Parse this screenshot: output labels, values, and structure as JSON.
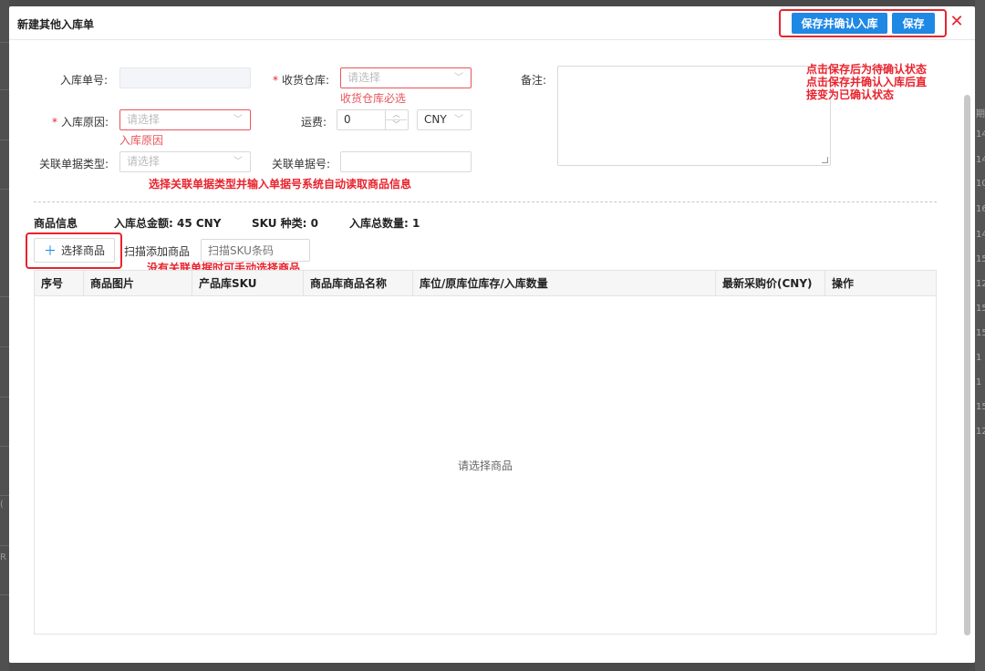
{
  "background": {
    "right_numbers": [
      "期",
      "14",
      "14",
      "10",
      "16",
      "14",
      "15",
      "12",
      "15",
      "15",
      "1",
      "1",
      "15",
      "12"
    ],
    "left_glyphs": [
      "(",
      "R"
    ]
  },
  "modal": {
    "title": "新建其他入库单",
    "buttons": {
      "confirm": "保存并确认入库",
      "save": "保存"
    },
    "close_icon": "close-icon"
  },
  "form": {
    "order_no_label": "入库单号:",
    "warehouse_label": "收货仓库:",
    "warehouse_placeholder": "请选择",
    "warehouse_error": "收货仓库必选",
    "remark_label": "备注:",
    "reason_label": "入库原因:",
    "reason_placeholder": "请选择",
    "reason_error": "入库原因",
    "freight_label": "运费:",
    "freight_value": "0",
    "currency_value": "CNY",
    "link_type_label": "关联单据类型:",
    "link_type_placeholder": "请选择",
    "link_no_label": "关联单据号:"
  },
  "annotations": {
    "save_note_line1": "点击保存后为待确认状态",
    "save_note_line2": "点击保存并确认入库后直",
    "save_note_line3": "接变为已确认状态",
    "link_note": "选择关联单据类型并输入单据号系统自动读取商品信息",
    "manual_note": "没有关联单据时可手动选择商品"
  },
  "goods": {
    "section_label": "商品信息",
    "total_amount": "入库总金额: 45 CNY",
    "sku_count": "SKU 种类: 0",
    "total_qty": "入库总数量: 1",
    "select_button": "选择商品",
    "scan_label": "扫描添加商品",
    "scan_placeholder": "扫描SKU条码"
  },
  "table": {
    "columns": [
      "序号",
      "商品图片",
      "产品库SKU",
      "商品库商品名称",
      "库位/原库位库存/入库数量",
      "最新采购价(CNY)",
      "操作"
    ],
    "empty_text": "请选择商品"
  },
  "colors": {
    "accent": "#1e88e5",
    "error": "#e8232d"
  }
}
